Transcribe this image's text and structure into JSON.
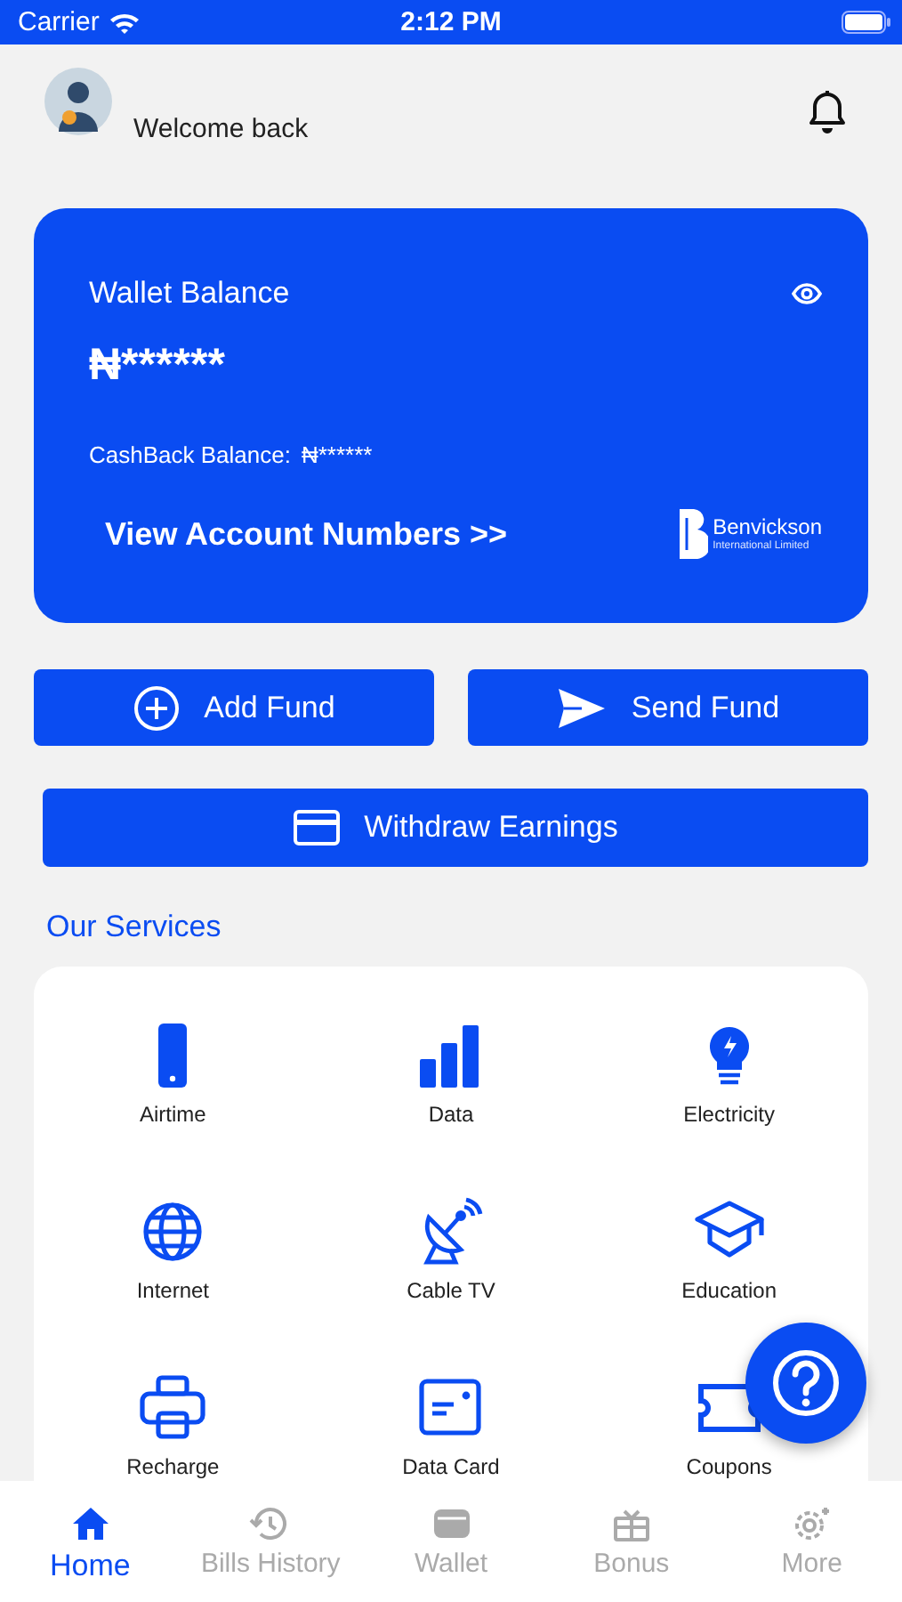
{
  "status_bar": {
    "carrier": "Carrier",
    "time": "2:12 PM"
  },
  "header": {
    "greeting": "Welcome back"
  },
  "wallet": {
    "title": "Wallet Balance",
    "balance": "₦******",
    "cashback_label": "CashBack Balance:",
    "cashback_value": "₦******",
    "link": "View Account Numbers >>",
    "logo_name": "Benvickson",
    "logo_sub": "International Limited"
  },
  "actions": [
    {
      "label": "Add Fund",
      "kind": "add"
    },
    {
      "label": "Send Fund",
      "kind": "send"
    }
  ],
  "withdraw": {
    "label": "Withdraw Earnings"
  },
  "services_title": "Our Services",
  "services": [
    {
      "label": "Airtime",
      "kind": "phone"
    },
    {
      "label": "Data",
      "kind": "bars"
    },
    {
      "label": "Electricity",
      "kind": "bulb"
    },
    {
      "label": "Internet",
      "kind": "globe"
    },
    {
      "label": "Cable TV",
      "kind": "dish"
    },
    {
      "label": "Education",
      "kind": "cap"
    },
    {
      "label": "Recharge",
      "kind": "printer"
    },
    {
      "label": "Data Card",
      "kind": "card"
    },
    {
      "label": "Coupons",
      "kind": "ticket"
    }
  ],
  "tabs": [
    {
      "label": "Home",
      "kind": "home",
      "selected": true
    },
    {
      "label": "Bills History",
      "kind": "history",
      "selected": false
    },
    {
      "label": "Wallet",
      "kind": "wallet",
      "selected": false
    },
    {
      "label": "Bonus",
      "kind": "gift",
      "selected": false
    },
    {
      "label": "More",
      "kind": "gear",
      "selected": false
    }
  ]
}
